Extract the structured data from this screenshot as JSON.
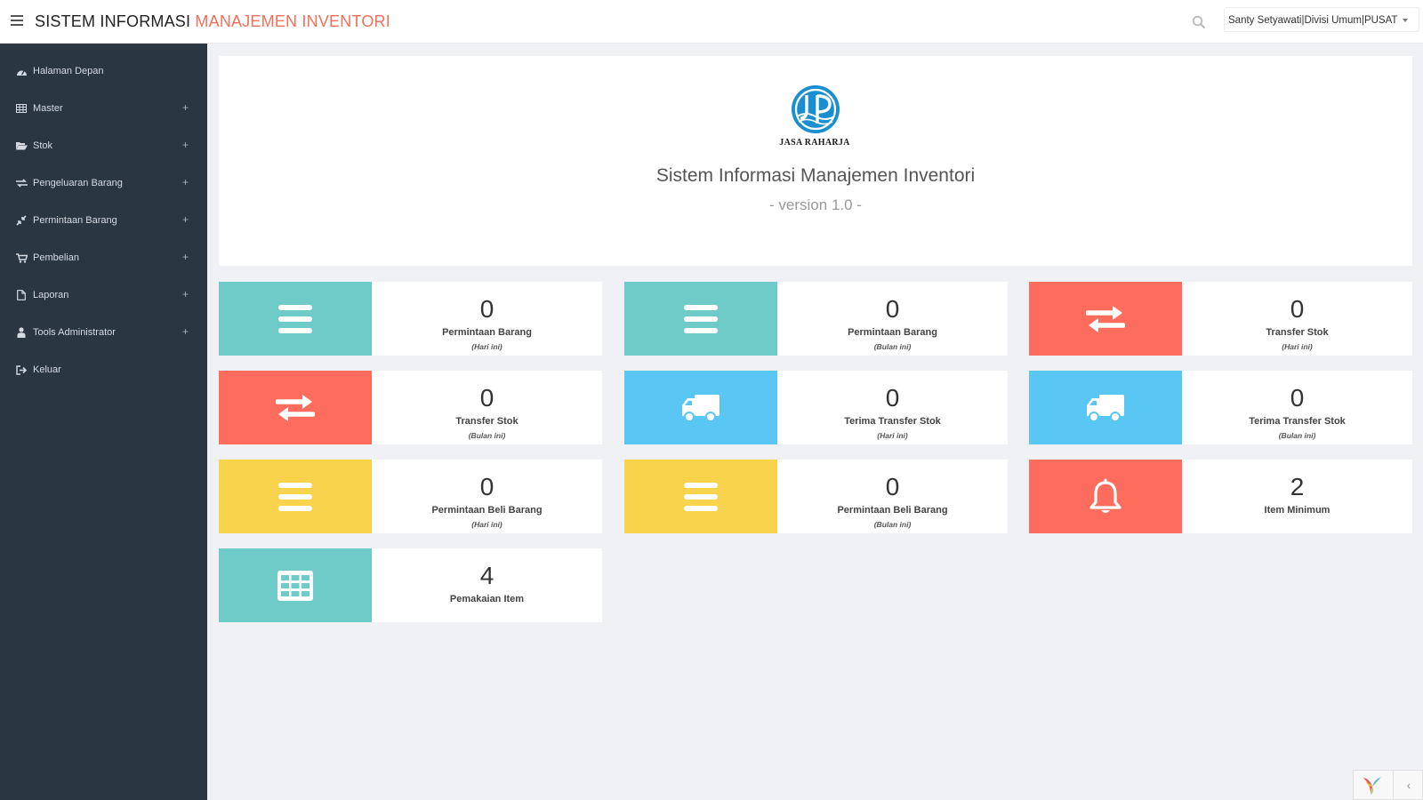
{
  "header": {
    "title_main": "SISTEM INFORMASI ",
    "title_accent": "MANAJEMEN INVENTORI",
    "user_menu": "Santy Setyawati|Divisi Umum|PUSAT"
  },
  "icons": {
    "menu": "hamburger-menu-icon",
    "search": "search-icon",
    "dashboard": "tachometer-icon",
    "master": "table-icon",
    "stok": "folder-open-icon",
    "pengeluaran": "exchange-icon",
    "permintaan": "compress-icon",
    "pembelian": "shopping-cart-icon",
    "laporan": "file-icon",
    "tools": "user-icon",
    "keluar": "sign-out-icon"
  },
  "sidebar": {
    "items": [
      {
        "label": "Halaman Depan",
        "expandable": false
      },
      {
        "label": "Master",
        "expandable": true
      },
      {
        "label": "Stok",
        "expandable": true
      },
      {
        "label": "Pengeluaran Barang",
        "expandable": true
      },
      {
        "label": "Permintaan Barang",
        "expandable": true
      },
      {
        "label": "Pembelian",
        "expandable": true
      },
      {
        "label": "Laporan",
        "expandable": true
      },
      {
        "label": "Tools Administrator",
        "expandable": true
      },
      {
        "label": "Keluar",
        "expandable": false
      }
    ],
    "expand_symbol": "+"
  },
  "hero": {
    "logo_text": "JASA RAHARJA",
    "title": "Sistem Informasi Manajemen Inventori",
    "version": "- version 1.0 -"
  },
  "colors": {
    "accent": "#f0705a",
    "sidebar_bg": "#2b3643",
    "teal": "#6fcbc8",
    "red": "#fd6c5c",
    "blue": "#59c6f3",
    "yellow": "#f8d34b"
  },
  "tiles": [
    {
      "count": "0",
      "label": "Permintaan Barang",
      "sub": "(Hari ini)",
      "icon": "list-icon",
      "color": "teal"
    },
    {
      "count": "0",
      "label": "Permintaan Barang",
      "sub": "(Bulan ini)",
      "icon": "list-icon",
      "color": "teal"
    },
    {
      "count": "0",
      "label": "Transfer Stok",
      "sub": "(Hari ini)",
      "icon": "exchange-icon",
      "color": "red"
    },
    {
      "count": "0",
      "label": "Transfer Stok",
      "sub": "(Bulan ini)",
      "icon": "exchange-icon",
      "color": "red"
    },
    {
      "count": "0",
      "label": "Terima Transfer Stok",
      "sub": "(Hari ini)",
      "icon": "truck-icon",
      "color": "blue"
    },
    {
      "count": "0",
      "label": "Terima Transfer Stok",
      "sub": "(Bulan ini)",
      "icon": "truck-icon",
      "color": "blue"
    },
    {
      "count": "0",
      "label": "Permintaan Beli Barang",
      "sub": "(Hari ini)",
      "icon": "list-icon",
      "color": "yellow"
    },
    {
      "count": "0",
      "label": "Permintaan Beli Barang",
      "sub": "(Bulan ini)",
      "icon": "list-icon",
      "color": "yellow"
    },
    {
      "count": "2",
      "label": "Item Minimum",
      "sub": "",
      "icon": "bell-icon",
      "color": "red"
    },
    {
      "count": "4",
      "label": "Pemakaian Item",
      "sub": "",
      "icon": "table-icon",
      "color": "teal"
    }
  ],
  "debug_toolbar": {
    "toggle_symbol": "‹",
    "logo_icon": "yii-logo-icon"
  }
}
